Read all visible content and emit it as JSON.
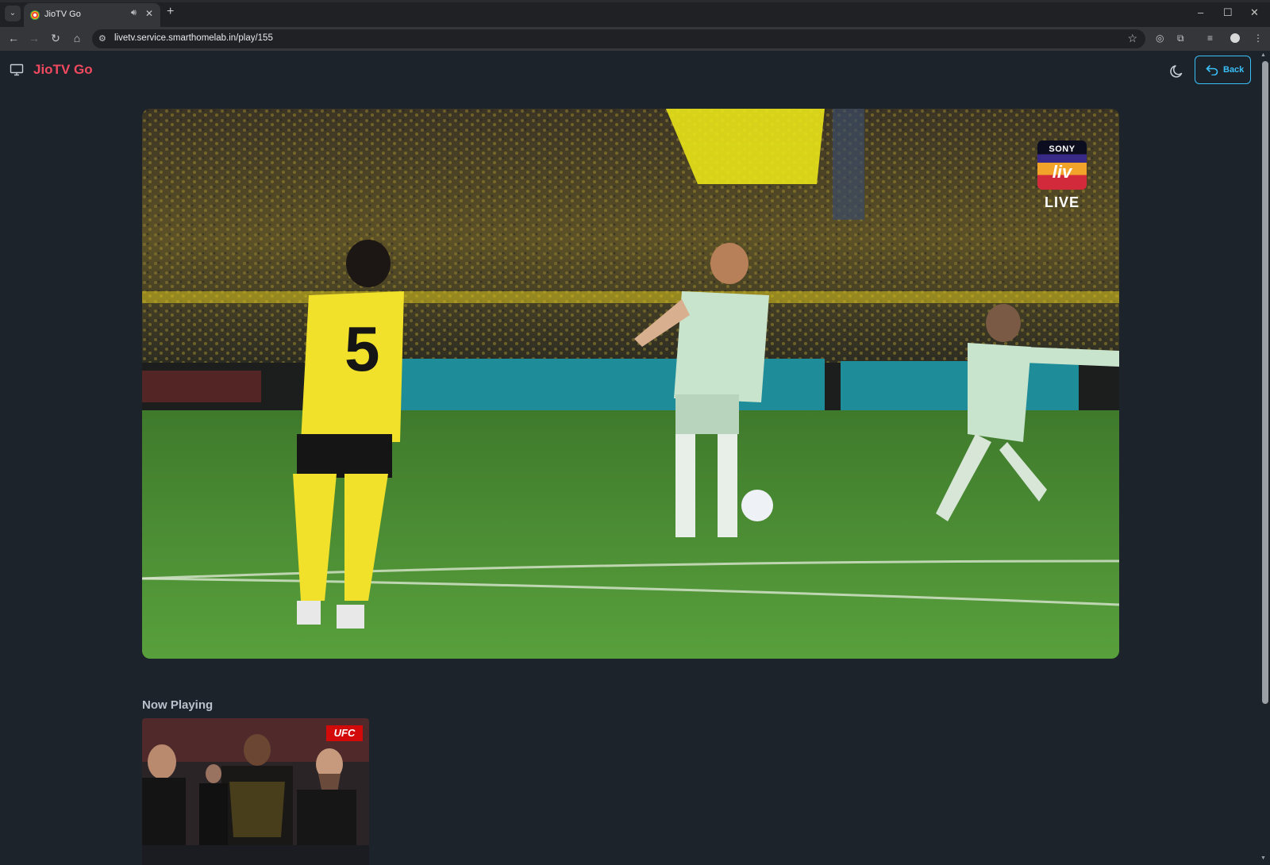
{
  "browser": {
    "tab_title": "JioTV Go",
    "url": "livetv.service.smarthomelab.in/play/155",
    "window_controls": [
      "–",
      "☐",
      "✕"
    ]
  },
  "app": {
    "brand": "JioTV Go",
    "back_label": "Back",
    "accent_color": "#3abff8",
    "brand_color": "#f1495f"
  },
  "player": {
    "channel_logo_top": "SONY",
    "channel_logo_main": "liv",
    "live_label": "LIVE"
  },
  "now_playing": {
    "heading": "Now Playing",
    "cards": [
      {
        "badge": "UFC"
      }
    ]
  },
  "icons": {
    "monitor": "monitor-icon",
    "theme": "moon-icon",
    "back": "undo-arrow-icon"
  }
}
